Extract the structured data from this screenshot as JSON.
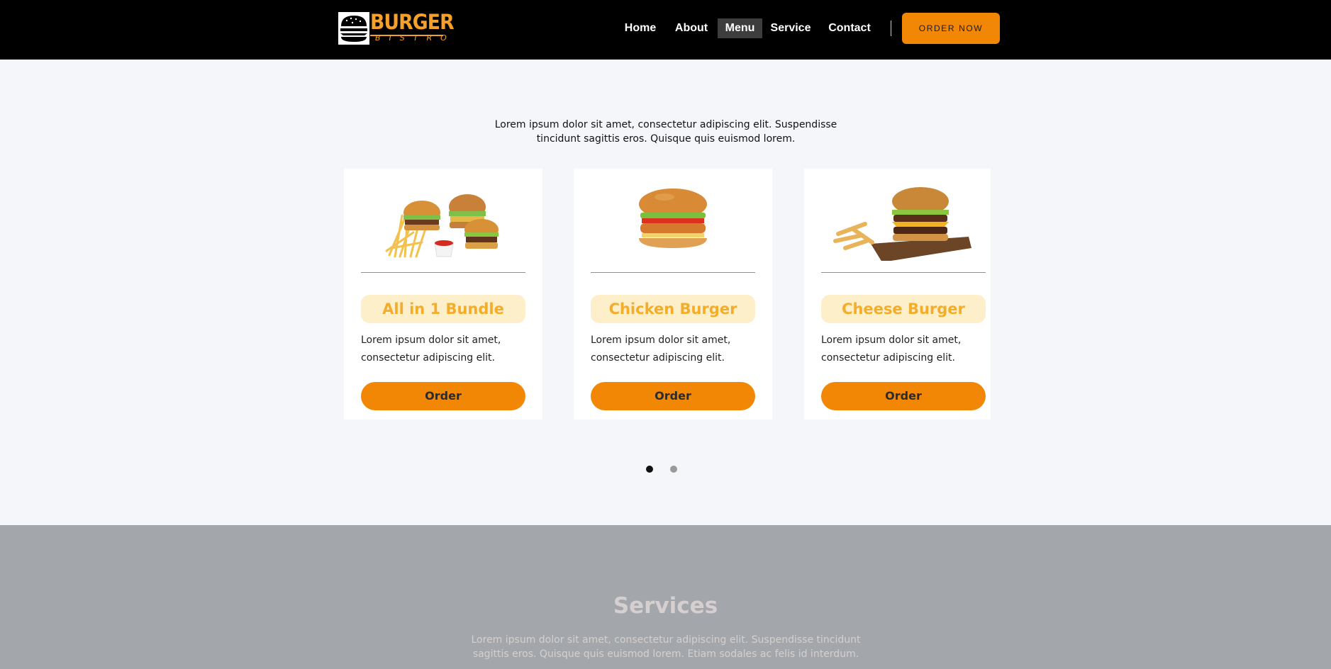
{
  "brand": {
    "word1": "BURGER",
    "word2": "BISTRO",
    "color": "#f5a02a"
  },
  "nav": {
    "links": [
      "Home",
      "About",
      "Menu",
      "Service",
      "Contact"
    ],
    "active": "Menu",
    "cta": "ORDER NOW"
  },
  "menu_section": {
    "intro": "Lorem ipsum dolor sit amet, consectetur adipiscing elit. Suspendisse tincidunt sagittis eros. Quisque quis euismod lorem.",
    "cards": [
      {
        "title": "All in 1 Bundle",
        "description": "Lorem ipsum dolor sit amet, consectetur adipiscing elit.",
        "button": "Order",
        "image": "burgers-with-fries-image"
      },
      {
        "title": "Chicken Burger",
        "description": "Lorem ipsum dolor sit amet, consectetur adipiscing elit.",
        "button": "Order",
        "image": "chicken-burger-image"
      },
      {
        "title": "Cheese Burger",
        "description": "Lorem ipsum dolor sit amet, consectetur adipiscing elit.",
        "button": "Order",
        "image": "cheese-burger-with-fries-image"
      }
    ],
    "carousel": {
      "page_count": 2,
      "active_page": 1
    }
  },
  "services": {
    "title": "Services",
    "text": "Lorem ipsum dolor sit amet, consectetur adipiscing elit. Suspendisse tincidunt sagittis eros. Quisque quis euismod lorem. Etiam sodales ac felis id interdum."
  },
  "colors": {
    "accent": "#f28705",
    "title_bg": "#fdefc9",
    "title_text": "#f4ad2a",
    "page_bg": "#f5f6fa",
    "services_bg": "#a3a6aa"
  }
}
